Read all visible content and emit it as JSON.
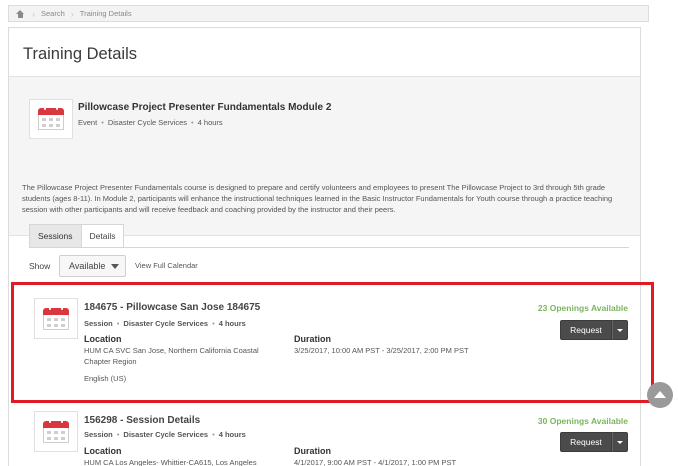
{
  "breadcrumb": {
    "home_icon": "home-icon",
    "items": [
      "Search",
      "Training Details"
    ]
  },
  "page": {
    "title": "Training Details"
  },
  "event": {
    "icon": "calendar-icon",
    "title": "Pillowcase Project Presenter Fundamentals Module 2",
    "type": "Event",
    "category": "Disaster Cycle Services",
    "duration": "4 hours",
    "description": "The Pillowcase Project Presenter Fundamentals course is designed to prepare and certify volunteers and employees to present The Pillowcase Project to 3rd through 5th grade students (ages 8-11). In Module 2, participants will enhance the instructional techniques learned in the Basic Instructor Fundamentals for Youth course through a practice teaching session with other participants and will receive feedback and coaching provided by the instructor and their peers."
  },
  "tabs": [
    {
      "label": "Sessions",
      "active": true
    },
    {
      "label": "Details",
      "active": false
    }
  ],
  "filter": {
    "show_label": "Show",
    "selected": "Available",
    "calendar_link": "View Full Calendar"
  },
  "sessions": [
    {
      "title": "184675 - Pillowcase San Jose 184675",
      "type": "Session",
      "category": "Disaster Cycle Services",
      "duration": "4 hours",
      "location_label": "Location",
      "location": "HUM CA SVC San Jose, Northern California Coastal Chapter Region",
      "language": "English (US)",
      "duration_label": "Duration",
      "date_range": "3/25/2017, 10:00 AM PST - 3/25/2017, 2:00 PM PST",
      "openings": "23 Openings Available",
      "button": "Request"
    },
    {
      "title": "156298 - Session Details",
      "type": "Session",
      "category": "Disaster Cycle Services",
      "duration": "4 hours",
      "location_label": "Location",
      "location": "HUM CA Los Angeles- Whittier-CA615, Los Angeles",
      "duration_label": "Duration",
      "date_range": "4/1/2017, 9:00 AM PST - 4/1/2017, 1:00 PM PST",
      "openings": "30 Openings Available",
      "button": "Request"
    }
  ],
  "colors": {
    "highlight": "#e01b24",
    "openings": "#7ab55c",
    "button": "#4b4b4b",
    "calendar_accent": "#d9363e"
  }
}
